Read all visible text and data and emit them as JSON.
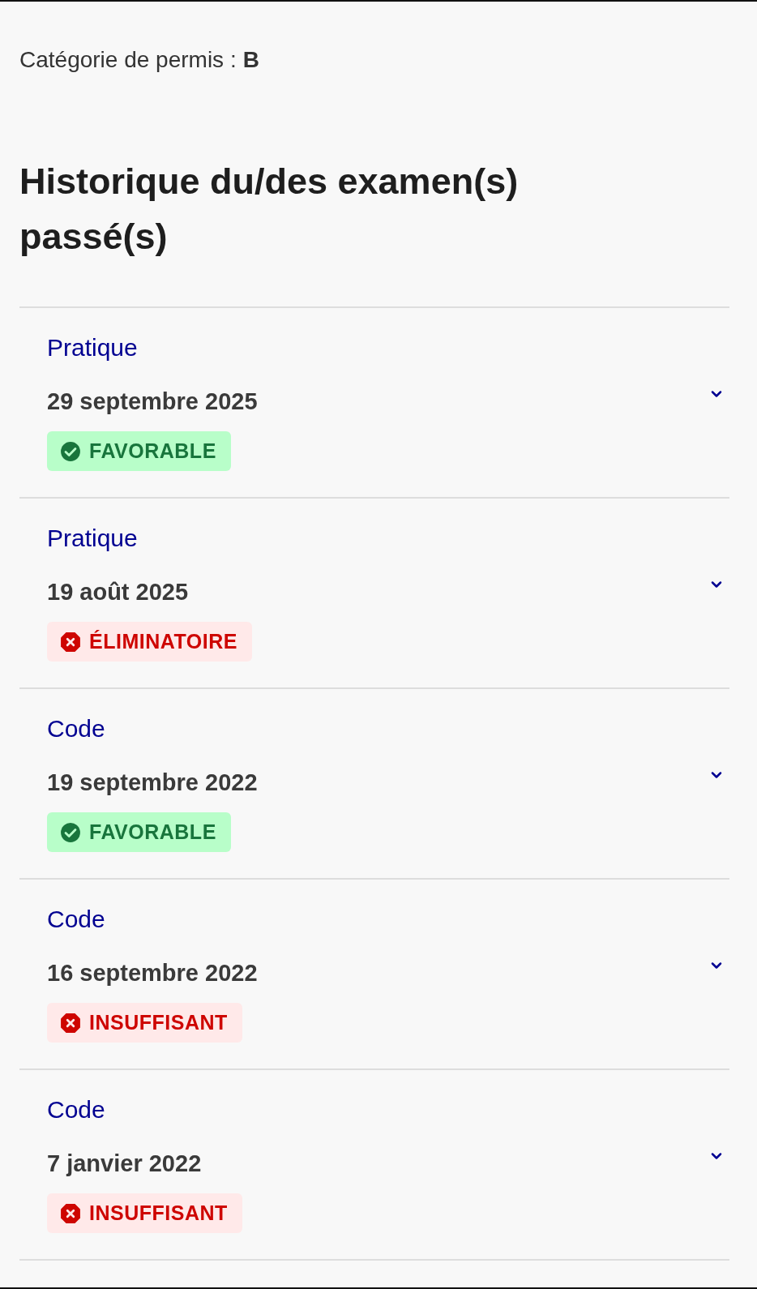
{
  "license_category": {
    "label": "Catégorie de permis :",
    "value": "B"
  },
  "heading": "Historique du/des examen(s) passé(s)",
  "exams": [
    {
      "type": "Pratique",
      "date": "29 septembre 2025",
      "result": {
        "kind": "success",
        "label": "FAVORABLE"
      }
    },
    {
      "type": "Pratique",
      "date": "19 août 2025",
      "result": {
        "kind": "error",
        "label": "ÉLIMINATOIRE"
      }
    },
    {
      "type": "Code",
      "date": "19 septembre 2022",
      "result": {
        "kind": "success",
        "label": "FAVORABLE"
      }
    },
    {
      "type": "Code",
      "date": "16 septembre 2022",
      "result": {
        "kind": "error",
        "label": "INSUFFISANT"
      }
    },
    {
      "type": "Code",
      "date": "7 janvier 2022",
      "result": {
        "kind": "error",
        "label": "INSUFFISANT"
      }
    }
  ]
}
